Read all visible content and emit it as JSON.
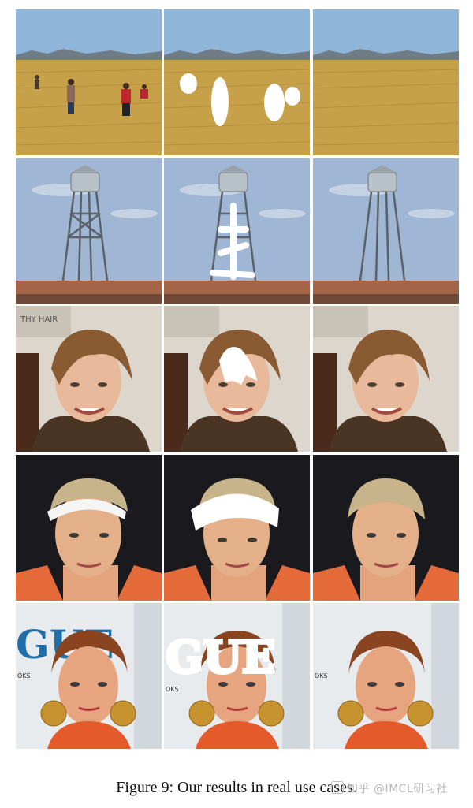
{
  "figure": {
    "caption": "Figure 9: Our results in real use cases.",
    "rows": [
      {
        "scene": "wheat-field-with-people",
        "columns": [
          "input",
          "masked",
          "result"
        ]
      },
      {
        "scene": "water-tower",
        "columns": [
          "input",
          "masked",
          "result"
        ]
      },
      {
        "scene": "woman-portrait",
        "columns": [
          "input",
          "masked",
          "result"
        ]
      },
      {
        "scene": "woman-headband",
        "columns": [
          "input",
          "masked",
          "result"
        ]
      },
      {
        "scene": "magazine-cover",
        "columns": [
          "input",
          "masked",
          "result"
        ]
      }
    ],
    "magazine_text": "GUE",
    "magazine_side_text": "OKS",
    "sign_text": "THY HAIR"
  },
  "watermark": {
    "text": "知乎 @IMCL研习社"
  }
}
